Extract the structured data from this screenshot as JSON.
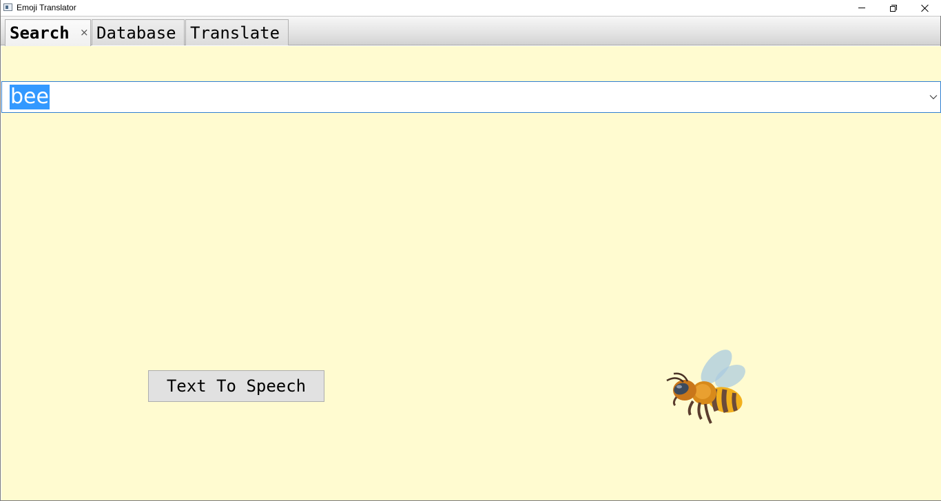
{
  "window": {
    "title": "Emoji Translator"
  },
  "tabs": [
    {
      "label": "Search",
      "active": true,
      "closable": true
    },
    {
      "label": "Database",
      "active": false
    },
    {
      "label": "Translate",
      "active": false
    }
  ],
  "search": {
    "value": "bee",
    "selected": true
  },
  "tts_button": {
    "label": "Text To Speech"
  },
  "emoji": {
    "icon": "honeybee-emoji"
  },
  "colors": {
    "content_background": "#fffbd0",
    "selection": "#3399ff",
    "combo_border": "#2f7fd1"
  }
}
